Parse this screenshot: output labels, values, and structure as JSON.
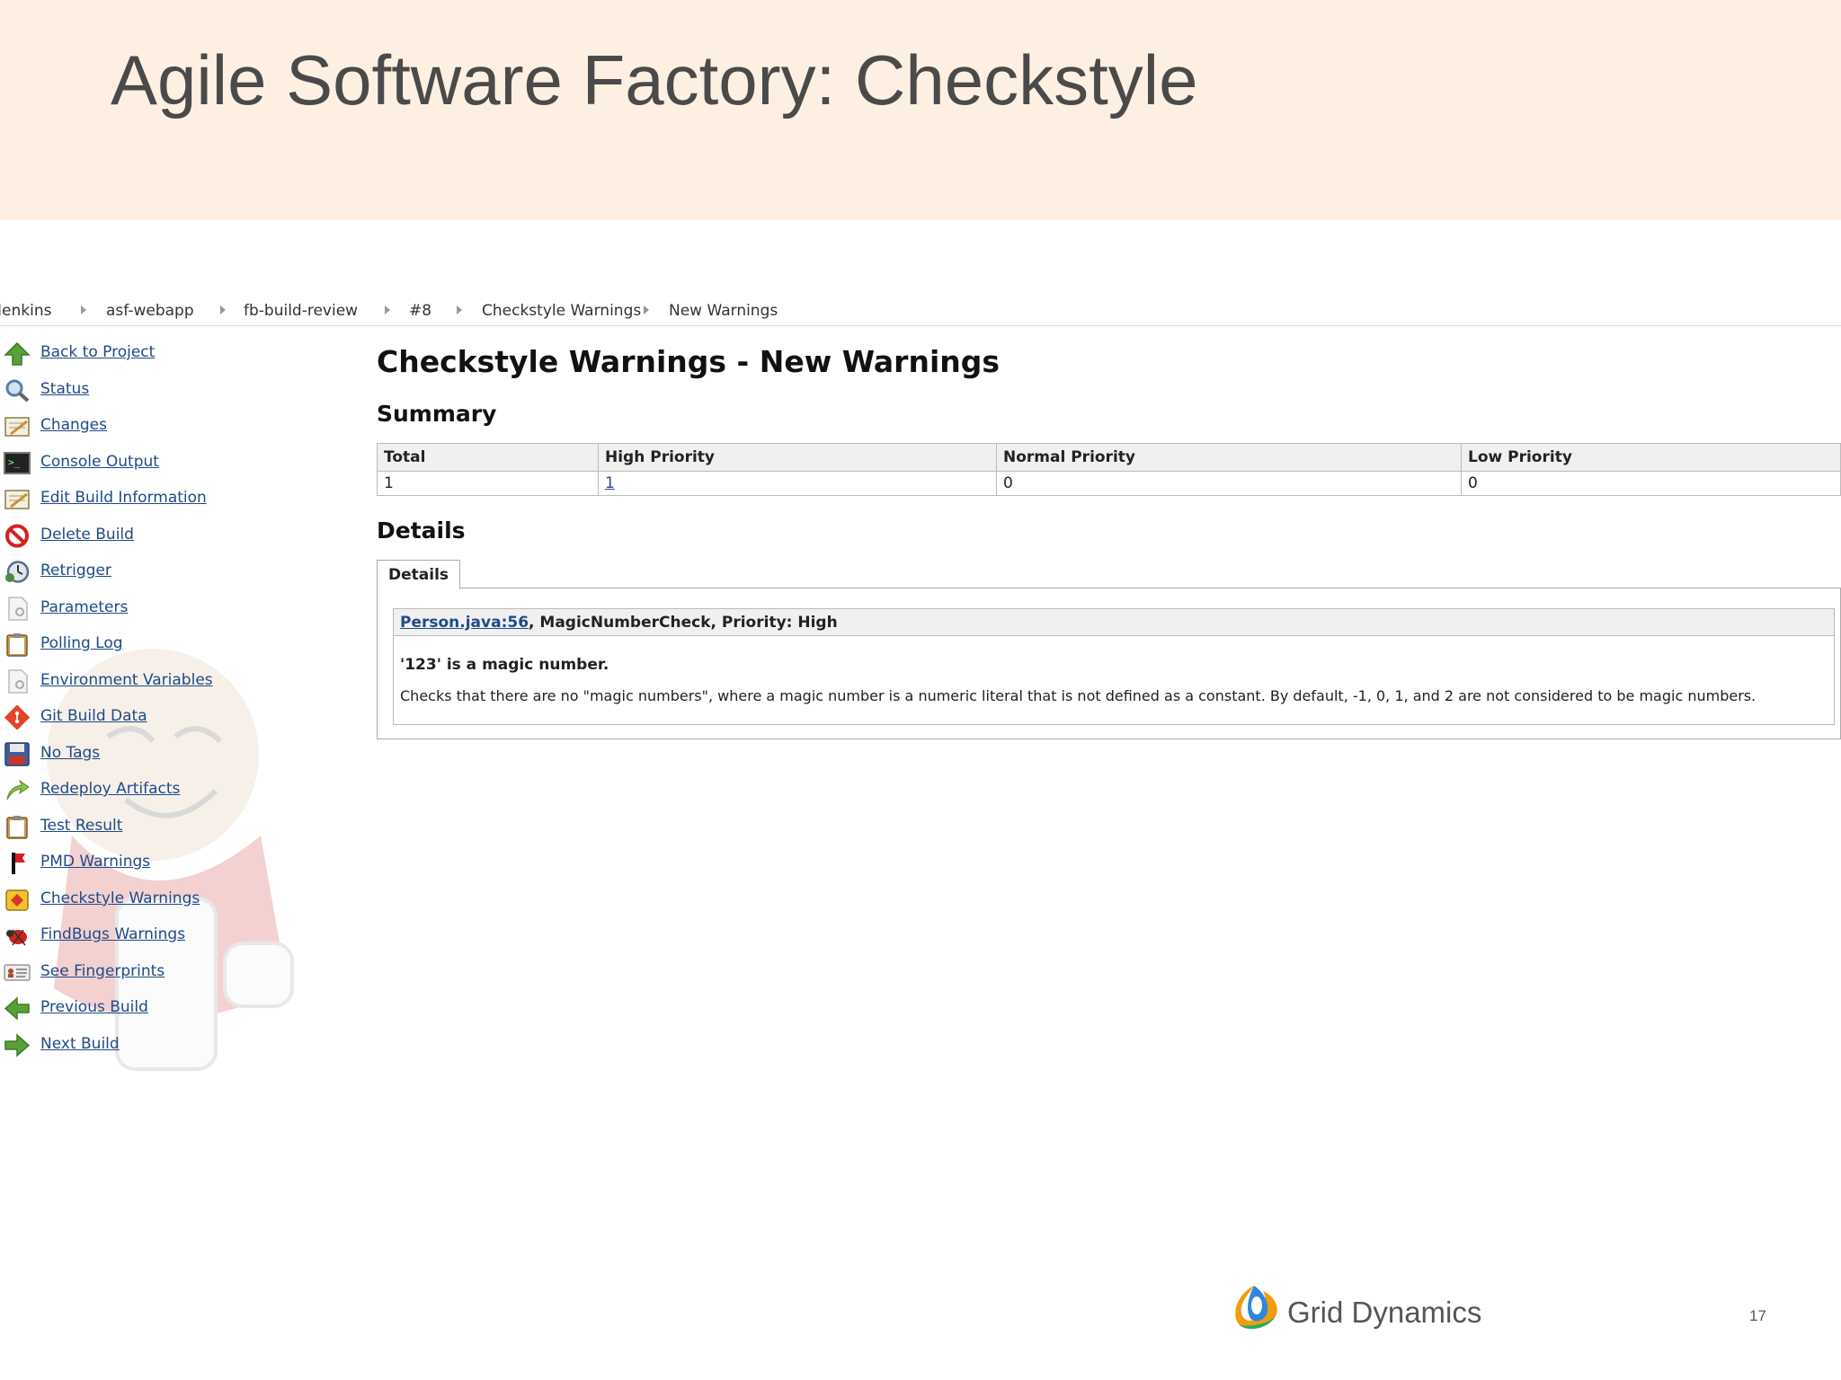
{
  "slide": {
    "title": "Agile Software Factory: Checkstyle",
    "page_number": "17",
    "brand": "Grid Dynamics"
  },
  "breadcrumb": [
    "Jenkins",
    "asf-webapp",
    "fb-build-review",
    "#8",
    "Checkstyle Warnings",
    "New Warnings"
  ],
  "sidebar": {
    "items": [
      {
        "label": "Back to Project",
        "icon": "up-arrow-icon"
      },
      {
        "label": "Status",
        "icon": "magnifier-icon"
      },
      {
        "label": "Changes",
        "icon": "notepad-icon"
      },
      {
        "label": "Console Output",
        "icon": "terminal-icon"
      },
      {
        "label": "Edit Build Information",
        "icon": "notepad-icon"
      },
      {
        "label": "Delete Build",
        "icon": "no-entry-icon"
      },
      {
        "label": "Retrigger",
        "icon": "clock-icon"
      },
      {
        "label": "Parameters",
        "icon": "document-icon"
      },
      {
        "label": "Polling Log",
        "icon": "clipboard-icon"
      },
      {
        "label": "Environment Variables",
        "icon": "document-icon"
      },
      {
        "label": "Git Build Data",
        "icon": "git-icon"
      },
      {
        "label": "No Tags",
        "icon": "floppy-icon"
      },
      {
        "label": "Redeploy Artifacts",
        "icon": "redeploy-icon"
      },
      {
        "label": "Test Result",
        "icon": "clipboard-icon"
      },
      {
        "label": "PMD Warnings",
        "icon": "pmd-flag-icon"
      },
      {
        "label": "Checkstyle Warnings",
        "icon": "checkstyle-icon"
      },
      {
        "label": "FindBugs Warnings",
        "icon": "bug-icon"
      },
      {
        "label": "See Fingerprints",
        "icon": "fingerprint-card-icon"
      },
      {
        "label": "Previous Build",
        "icon": "left-arrow-icon"
      },
      {
        "label": "Next Build",
        "icon": "right-arrow-icon"
      }
    ]
  },
  "main": {
    "title": "Checkstyle Warnings - New Warnings",
    "summary_heading": "Summary",
    "summary": {
      "headers": [
        "Total",
        "High Priority",
        "Normal Priority",
        "Low Priority"
      ],
      "values": [
        "1",
        "1",
        "0",
        "0"
      ]
    },
    "details_heading": "Details",
    "tab_label": "Details",
    "warning": {
      "location": "Person.java:56",
      "rest": ", MagicNumberCheck, Priority: High",
      "title": "'123' is a magic number.",
      "description": "Checks that there are no \"magic numbers\", where a magic number is a numeric literal that is not defined as a constant. By default, -1, 0, 1, and 2 are not considered to be magic numbers."
    }
  },
  "colors": {
    "header_bg": "#fdf0e2",
    "link": "#204a87",
    "title_text": "#4a4a4a"
  }
}
